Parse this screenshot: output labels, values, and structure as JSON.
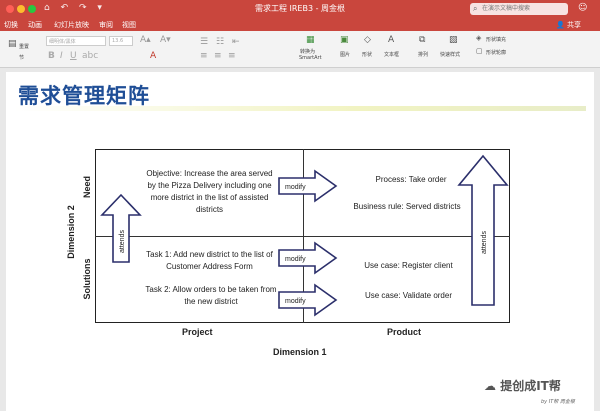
{
  "window": {
    "title": "需求工程 IREB3 - 周金根",
    "search_placeholder": "在演示文稿中搜索"
  },
  "tabs": [
    "切换",
    "动画",
    "幻灯片放映",
    "审阅",
    "视图"
  ],
  "share_label": "共享",
  "ribbon": {
    "reset": "重置",
    "section": "节",
    "font_name": "细明体/黑体",
    "font_size": "13.6",
    "convert_smartart_1": "转换为",
    "convert_smartart_2": "SmartArt",
    "picture": "图片",
    "shape": "形状",
    "textbox": "文本框",
    "arrange": "排列",
    "quick_styles": "快速样式",
    "shape_fill": "形状填充",
    "shape_outline": "形状轮廓"
  },
  "slide": {
    "title": "需求管理矩阵",
    "need_cell": "Objective: Increase the area served by the Pizza Delivery including one more district in the list of assisted districts",
    "process": "Process: Take order",
    "business_rule": "Business rule: Served districts",
    "task1": "Task 1: Add new district to the list of Customer Address Form",
    "task2": "Task 2: Allow orders to be taken from the new district",
    "use_case1": "Use case: Register client",
    "use_case2": "Use case: Validate order",
    "modify": "modify",
    "attends": "attends",
    "row_need": "Need",
    "row_solutions": "Solutions",
    "dimension2": "Dimension 2",
    "col_project": "Project",
    "col_product": "Product",
    "dimension1": "Dimension 1"
  },
  "watermark": {
    "text": "提创成IT帮",
    "sub": "by IT帮 周金根"
  }
}
